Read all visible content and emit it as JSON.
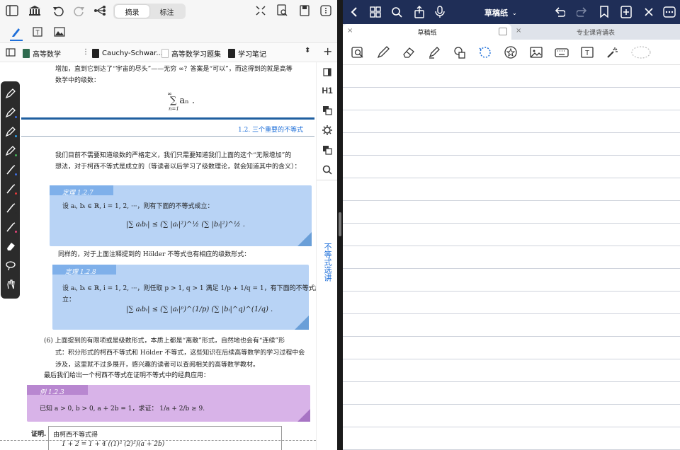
{
  "left_toolbar": {
    "seg_left": "摘录",
    "seg_right": "标注"
  },
  "tabs": [
    {
      "label": "高等数学",
      "color": "#2f6b4f"
    },
    {
      "label": "Cauchy-Schwar...",
      "color": "#222222"
    },
    {
      "label": "高等数学习题集",
      "color": "#ffffff"
    },
    {
      "label": "学习笔记",
      "color": "#222222"
    }
  ],
  "doc": {
    "top_text_1": "增加，直到它到达了“宇宙的尽头”——无穷 ∞？答案是“可以”，而这得到的就是高等",
    "top_text_2": "数学中的级数：",
    "series": "∑ aₙ .",
    "series_top": "∞",
    "series_bottom": "n=1",
    "section_header": "1.2.  三个重要的不等式",
    "intro_1": "我们目前不需要知道级数的严格定义，我们只需要知道我们上面的这个“无限增加”的",
    "intro_2": "想法，对于柯西不等式是成立的（等读者以后学习了级数理论，就会知道其中的含义）：",
    "thm1_title": "定理 1.2.7",
    "thm1_text": "设 aᵢ, bᵢ ∈ ℝ, i = 1, 2, ···，则有下面的不等式成立：",
    "thm1_formula": "|∑ aᵢbᵢ| ≤ (∑ |aᵢ|²)^½ (∑ |bᵢ|²)^½ .",
    "middle_text": "同样的，对于上面注释提到的 Hölder 不等式也有相应的级数形式：",
    "thm2_title": "定理 1.2.8",
    "thm2_text_1": "设 aᵢ, bᵢ ∈ ℝ, i = 1, 2, ···，则任取 p > 1, q > 1 满足 1/p + 1/q = 1，有下面的不等式成",
    "thm2_text_2": "立：",
    "thm2_formula": "|∑ aᵢbᵢ| ≤ (∑ |aᵢ|ᵖ)^(1/p) (∑ |bᵢ|^q)^(1/q) .",
    "note_1": "(6)  上面提到的有限项或是级数形式，本质上都是“离散”形式，自然地也会有“连续”形",
    "note_2": "式：积分形式的柯西不等式和 Hölder 不等式，这些知识在后续高等数学的学习过程中会",
    "note_3": "涉及，这里就不过多展开，感兴趣的读者可以查阅相关的高等数学教材。",
    "final_text": "最后我们给出一个柯西不等式在证明不等式中的经典应用：",
    "ex_title": "例 1.2.3",
    "ex_text": "已知 a > 0, b > 0, a + 2b = 1，求证： 1/a + 2/b ≥ 9.",
    "proof_label": "证明.",
    "proof_text": "由柯西不等式得",
    "proof_formula": "1 + 2 = 1 + 4  ((1)²  (2)²)(a + 2b)"
  },
  "sidebar": {
    "h1": "H1",
    "vertical_label": "不等式选讲"
  },
  "right": {
    "title": "草稿纸",
    "tab1": "草稿纸",
    "tab2": "专业课背诵表"
  },
  "colors": {
    "accent": "#1e6fd9",
    "right_topbar": "#1f2e57",
    "theorem_box": "#b8d3f5",
    "example_box": "#d8b3e8"
  }
}
